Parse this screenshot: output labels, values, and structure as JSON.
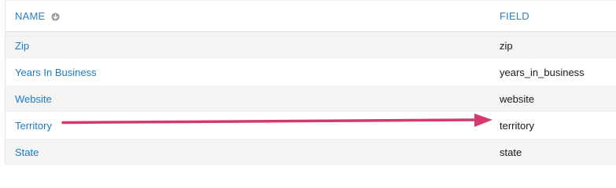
{
  "table": {
    "columns": {
      "name": "NAME",
      "field": "FIELD"
    },
    "rows": [
      {
        "name": "Zip",
        "field": "zip"
      },
      {
        "name": "Years In Business",
        "field": "years_in_business"
      },
      {
        "name": "Website",
        "field": "website"
      },
      {
        "name": "Territory",
        "field": "territory"
      },
      {
        "name": "State",
        "field": "state"
      }
    ]
  },
  "icons": {
    "sort": "sort-down-circle-icon"
  },
  "colors": {
    "link": "#1b7cc4",
    "header": "#2a80c2",
    "annotation_arrow": "#d63a6a"
  }
}
